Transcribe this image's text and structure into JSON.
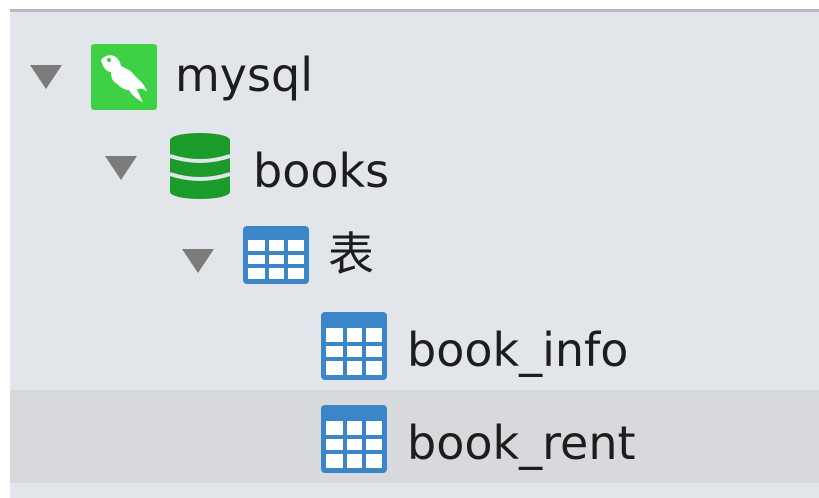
{
  "tree": {
    "connection": {
      "label": "mysql",
      "icon": "mysql-dolphin-icon",
      "expanded": true,
      "color": "#3ed146"
    },
    "database": {
      "label": "books",
      "icon": "database-icon",
      "expanded": true,
      "color": "#1b9c2a"
    },
    "table_group": {
      "label": "表",
      "icon": "table-icon",
      "expanded": true,
      "color": "#3a86c8"
    },
    "tables": [
      {
        "label": "book_info",
        "icon": "table-icon",
        "selected": false
      },
      {
        "label": "book_rent",
        "icon": "table-icon",
        "selected": true
      }
    ]
  }
}
